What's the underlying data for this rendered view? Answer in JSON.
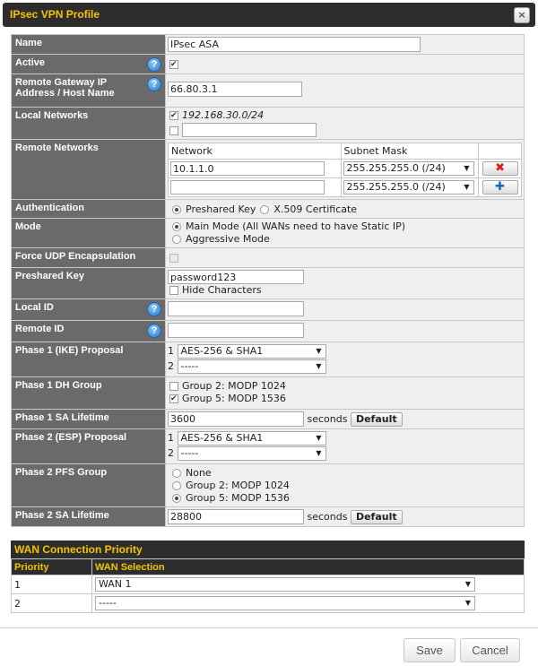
{
  "dialog": {
    "title": "IPsec VPN Profile",
    "close": "×"
  },
  "form": {
    "name_label": "Name",
    "name_value": "IPsec ASA",
    "active_label": "Active",
    "gateway_label": "Remote Gateway IP Address / Host Name",
    "gateway_value": "66.80.3.1",
    "local_networks_label": "Local Networks",
    "local_network_1": "192.168.30.0/24",
    "local_network_2": "",
    "remote_networks_label": "Remote Networks",
    "remote_networks": {
      "col_network": "Network",
      "col_mask": "Subnet Mask",
      "rows": [
        {
          "network": "10.1.1.0",
          "mask": "255.255.255.0 (/24)",
          "action": "delete"
        },
        {
          "network": "",
          "mask": "255.255.255.0 (/24)",
          "action": "add"
        }
      ]
    },
    "auth_label": "Authentication",
    "auth_preshared": "Preshared Key",
    "auth_x509": "X.509 Certificate",
    "mode_label": "Mode",
    "mode_main": "Main Mode (All WANs need to have Static IP)",
    "mode_aggressive": "Aggressive Mode",
    "force_udp_label": "Force UDP Encapsulation",
    "psk_label": "Preshared Key",
    "psk_value": "password123",
    "psk_hide": "Hide Characters",
    "local_id_label": "Local ID",
    "local_id_value": "",
    "remote_id_label": "Remote ID",
    "remote_id_value": "",
    "p1_proposal_label": "Phase 1 (IKE) Proposal",
    "p1_num1": "1",
    "p1_opt1": "AES-256 & SHA1",
    "p1_num2": "2",
    "p1_opt2": "-----",
    "p1_dh_label": "Phase 1 DH Group",
    "p1_dh_g2": "Group 2: MODP 1024",
    "p1_dh_g5": "Group 5: MODP 1536",
    "p1_lifetime_label": "Phase 1 SA Lifetime",
    "p1_lifetime_value": "3600",
    "seconds": "seconds",
    "default_btn": "Default",
    "p2_proposal_label": "Phase 2 (ESP) Proposal",
    "p2_num1": "1",
    "p2_opt1": "AES-256 & SHA1",
    "p2_num2": "2",
    "p2_opt2": "-----",
    "p2_pfs_label": "Phase 2 PFS Group",
    "p2_pfs_none": "None",
    "p2_pfs_g2": "Group 2: MODP 1024",
    "p2_pfs_g5": "Group 5: MODP 1536",
    "p2_lifetime_label": "Phase 2 SA Lifetime",
    "p2_lifetime_value": "28800"
  },
  "wan": {
    "title": "WAN Connection Priority",
    "col_priority": "Priority",
    "col_selection": "WAN Selection",
    "rows": [
      {
        "priority": "1",
        "selection": "WAN 1"
      },
      {
        "priority": "2",
        "selection": "-----"
      }
    ]
  },
  "footer": {
    "save": "Save",
    "cancel": "Cancel"
  },
  "icons": {
    "help": "?",
    "delete": "✖",
    "add": "✚",
    "arrow": "▼"
  },
  "colors": {
    "title_accent": "#f5c400",
    "label_bg": "#6a6a6a",
    "delete_red": "#d91e1e",
    "add_blue": "#1f66c2"
  }
}
